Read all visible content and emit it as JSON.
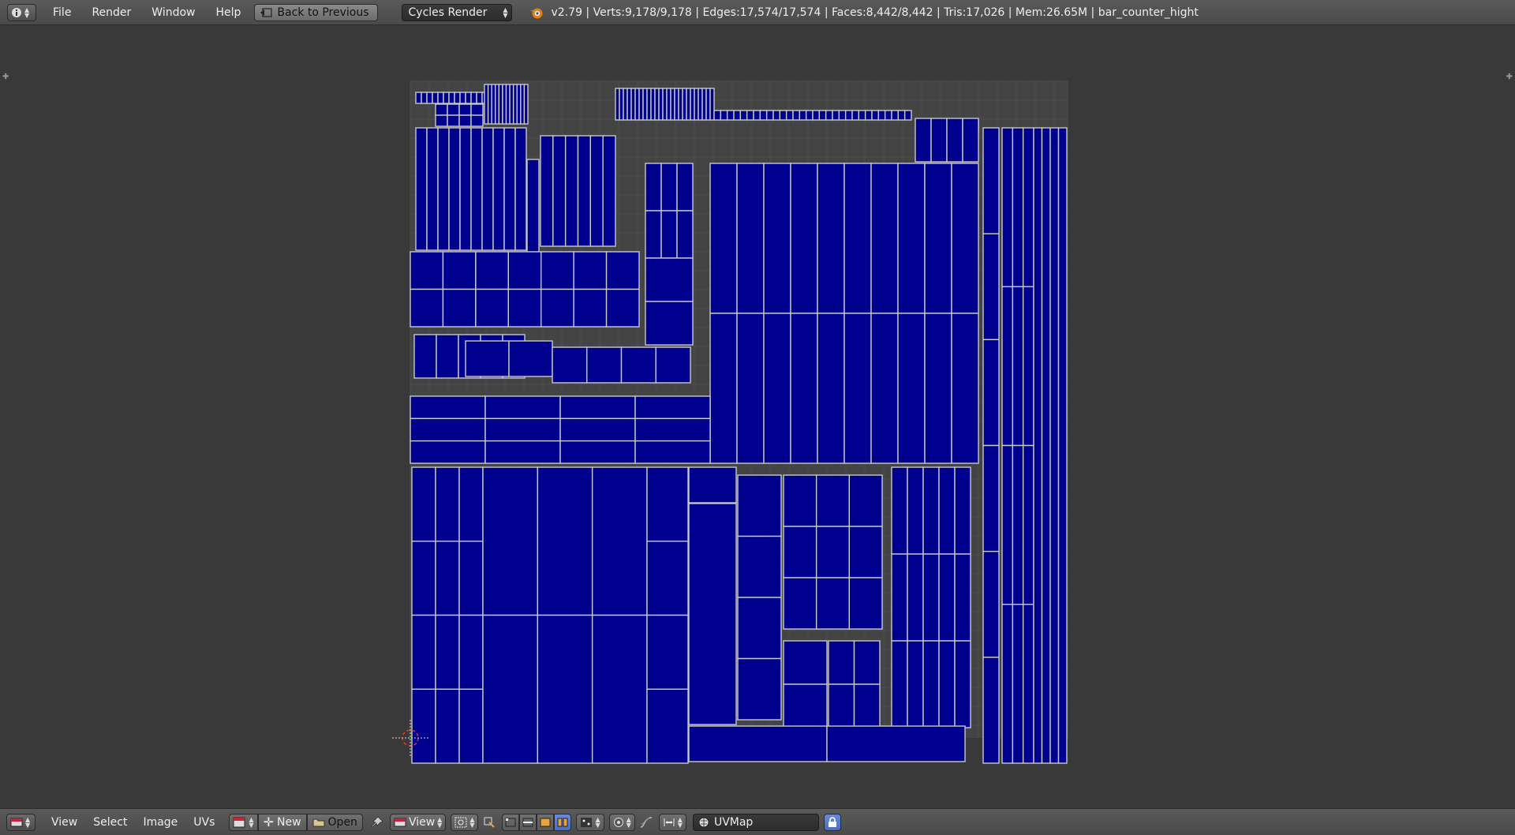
{
  "top_header": {
    "menu": [
      "File",
      "Render",
      "Window",
      "Help"
    ],
    "back_button_label": "Back to Previous",
    "render_engine": "Cycles Render",
    "stats": "v2.79 | Verts:9,178/9,178 | Edges:17,574/17,574 | Faces:8,442/8,442 | Tris:17,026 | Mem:26.65M | bar_counter_hight"
  },
  "bottom_header": {
    "menu": [
      "View",
      "Select",
      "Image",
      "UVs"
    ],
    "new_label": "New",
    "open_label": "Open",
    "view_label": "View",
    "uv_map": "UVMap"
  },
  "colors": {
    "uv_face": "#00008e",
    "uv_edge": "#c8c8c8",
    "background": "#393939",
    "grid_bg": "#444444",
    "header": "#4f4f4f",
    "accent_blue": "#5680c2"
  }
}
